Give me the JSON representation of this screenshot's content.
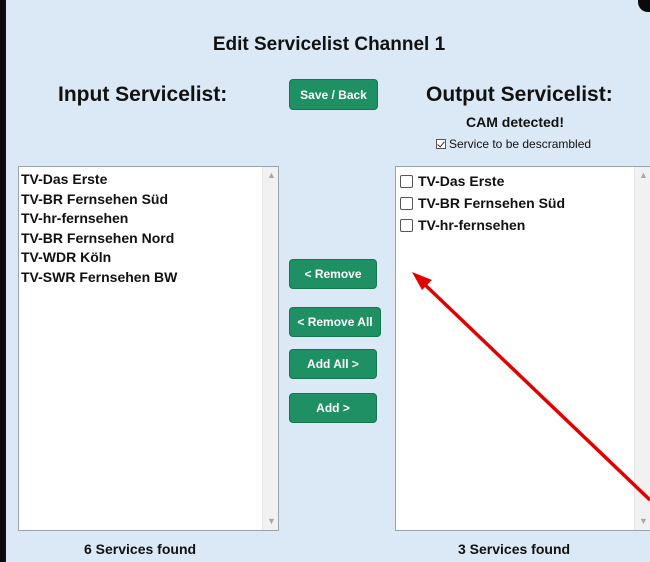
{
  "dialog": {
    "title": "Edit Servicelist Channel 1",
    "save_back_label": "Save / Back",
    "input": {
      "header": "Input Servicelist:",
      "items": [
        "TV-Das Erste",
        "TV-BR Fernsehen Süd",
        "TV-hr-fernsehen",
        "TV-BR Fernsehen Nord",
        "TV-WDR Köln",
        "TV-SWR Fernsehen BW"
      ],
      "count_label": "6 Services found"
    },
    "output": {
      "header": "Output Servicelist:",
      "cam_status": "CAM detected!",
      "descramble_label": "Service to be descrambled",
      "descramble_checked": true,
      "items": [
        {
          "label": "TV-Das Erste",
          "checked": false
        },
        {
          "label": "TV-BR Fernsehen Süd",
          "checked": false
        },
        {
          "label": "TV-hr-fernsehen",
          "checked": false
        }
      ],
      "count_label": "3 Services found"
    },
    "actions": {
      "remove": "< Remove",
      "remove_all": "< Remove All",
      "add_all": "Add All >",
      "add": "Add >"
    }
  },
  "colors": {
    "background": "#dbe9f7",
    "button": "#1f8f64",
    "annotation_arrow": "#e00000"
  },
  "icons": {
    "scroll_up": "▲",
    "scroll_down": "▼"
  }
}
